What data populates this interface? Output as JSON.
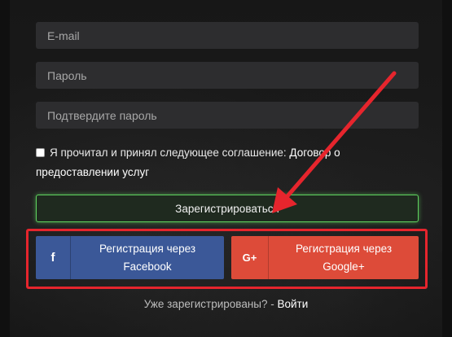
{
  "form": {
    "email_placeholder": "E-mail",
    "password_placeholder": "Пароль",
    "confirm_placeholder": "Подтвердите пароль",
    "agree_text": "Я прочитал и принял следующее соглашение: ",
    "agree_link": "Договор о предоставлении услуг",
    "agree_checked": false,
    "register_label": "Зарегистрироваться"
  },
  "social": {
    "facebook_icon": "f",
    "facebook_label": "Регистрация через Facebook",
    "facebook_color": "#3b5898",
    "google_icon": "G+",
    "google_label": "Регистрация через Google+",
    "google_color": "#dd4b39"
  },
  "footer": {
    "already_text": "Уже зарегистрированы? - ",
    "login_link": "Войти"
  },
  "annotation": {
    "color": "#e6252d"
  }
}
